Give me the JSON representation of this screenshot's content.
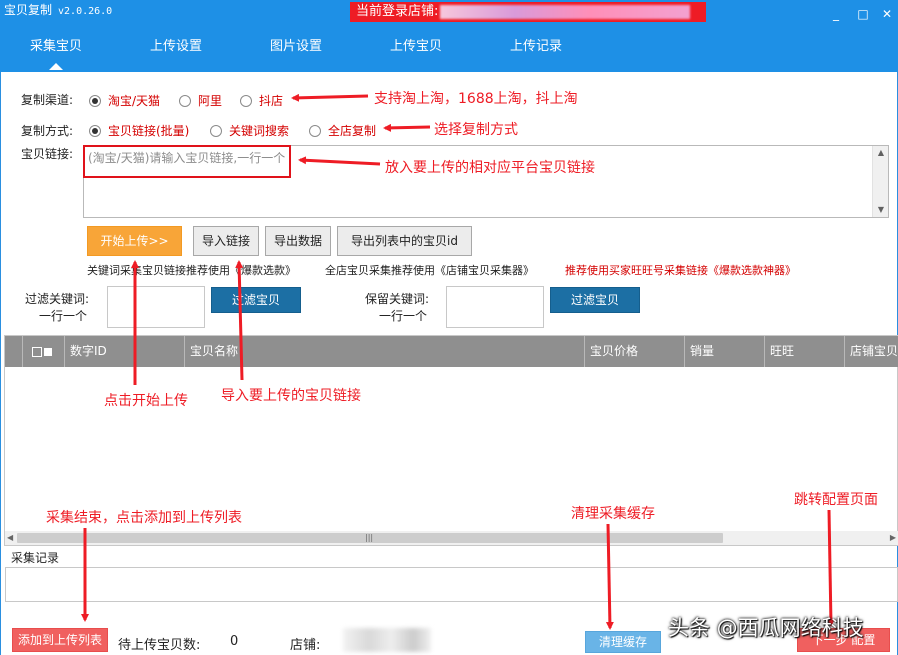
{
  "app": {
    "title": "宝贝复制",
    "version": "v2.0.26.0",
    "login_banner": "当前登录店铺:"
  },
  "window_buttons": {
    "minimize": "_",
    "maximize": "□",
    "close": "✕"
  },
  "nav": {
    "tabs": [
      "采集宝贝",
      "上传设置",
      "图片设置",
      "上传宝贝",
      "上传记录"
    ],
    "active": "采集宝贝"
  },
  "form": {
    "channel_label": "复制渠道:",
    "channel_options": [
      {
        "label": "淘宝/天猫",
        "checked": true
      },
      {
        "label": "阿里",
        "checked": false
      },
      {
        "label": "抖店",
        "checked": false
      }
    ],
    "mode_label": "复制方式:",
    "mode_options": [
      {
        "label": "宝贝链接(批量)",
        "checked": true
      },
      {
        "label": "关键词搜索",
        "checked": false
      },
      {
        "label": "全店复制",
        "checked": false
      }
    ],
    "link_label": "宝贝链接:",
    "link_placeholder": "(淘宝/天猫)请输入宝贝链接,一行一个"
  },
  "actions": {
    "start": "开始上传>>",
    "import": "导入链接",
    "export": "导出数据",
    "export_ids": "导出列表中的宝贝id"
  },
  "hints": {
    "keyword": "关键词采集宝贝链接推荐使用《爆款选款》",
    "shop": "全店宝贝采集推荐使用《店铺宝贝采集器》",
    "buyer": "推荐使用买家旺旺号采集链接《爆款选款神器》"
  },
  "filters": {
    "filter_label_1": "过滤关键词:",
    "filter_label_2": "一行一个",
    "filter_button": "过滤宝贝",
    "keep_label_1": "保留关键词:",
    "keep_label_2": "一行一个",
    "keep_button": "过滤宝贝"
  },
  "table": {
    "columns": [
      "数字ID",
      "宝贝名称",
      "宝贝价格",
      "销量",
      "旺旺",
      "店铺宝贝"
    ],
    "rows": []
  },
  "log": {
    "label": "采集记录"
  },
  "footer": {
    "add_button": "添加到上传列表",
    "pending_label": "待上传宝贝数:",
    "pending_count": "0",
    "shop_label": "店铺:",
    "clear_cache": "清理缓存",
    "next_button": "下一步 配置"
  },
  "annotations": {
    "channel_note": "支持淘上淘，1688上淘，抖上淘",
    "mode_note": "选择复制方式",
    "link_note": "放入要上传的相对应平台宝贝链接",
    "start_note": "点击开始上传",
    "import_note": "导入要上传的宝贝链接",
    "add_note": "采集结束，点击添加到上传列表",
    "cache_note": "清理采集缓存",
    "next_note": "跳转配置页面"
  },
  "watermark": "头条 @西瓜网络科技",
  "colors": {
    "nav_bg": "#1e90e6",
    "banner_bg": "#ee1c25",
    "annotation": "#ee1c25",
    "start_button": "#f8a538",
    "filter_button": "#1c6fa4",
    "header_bg": "#8f8f8f"
  }
}
